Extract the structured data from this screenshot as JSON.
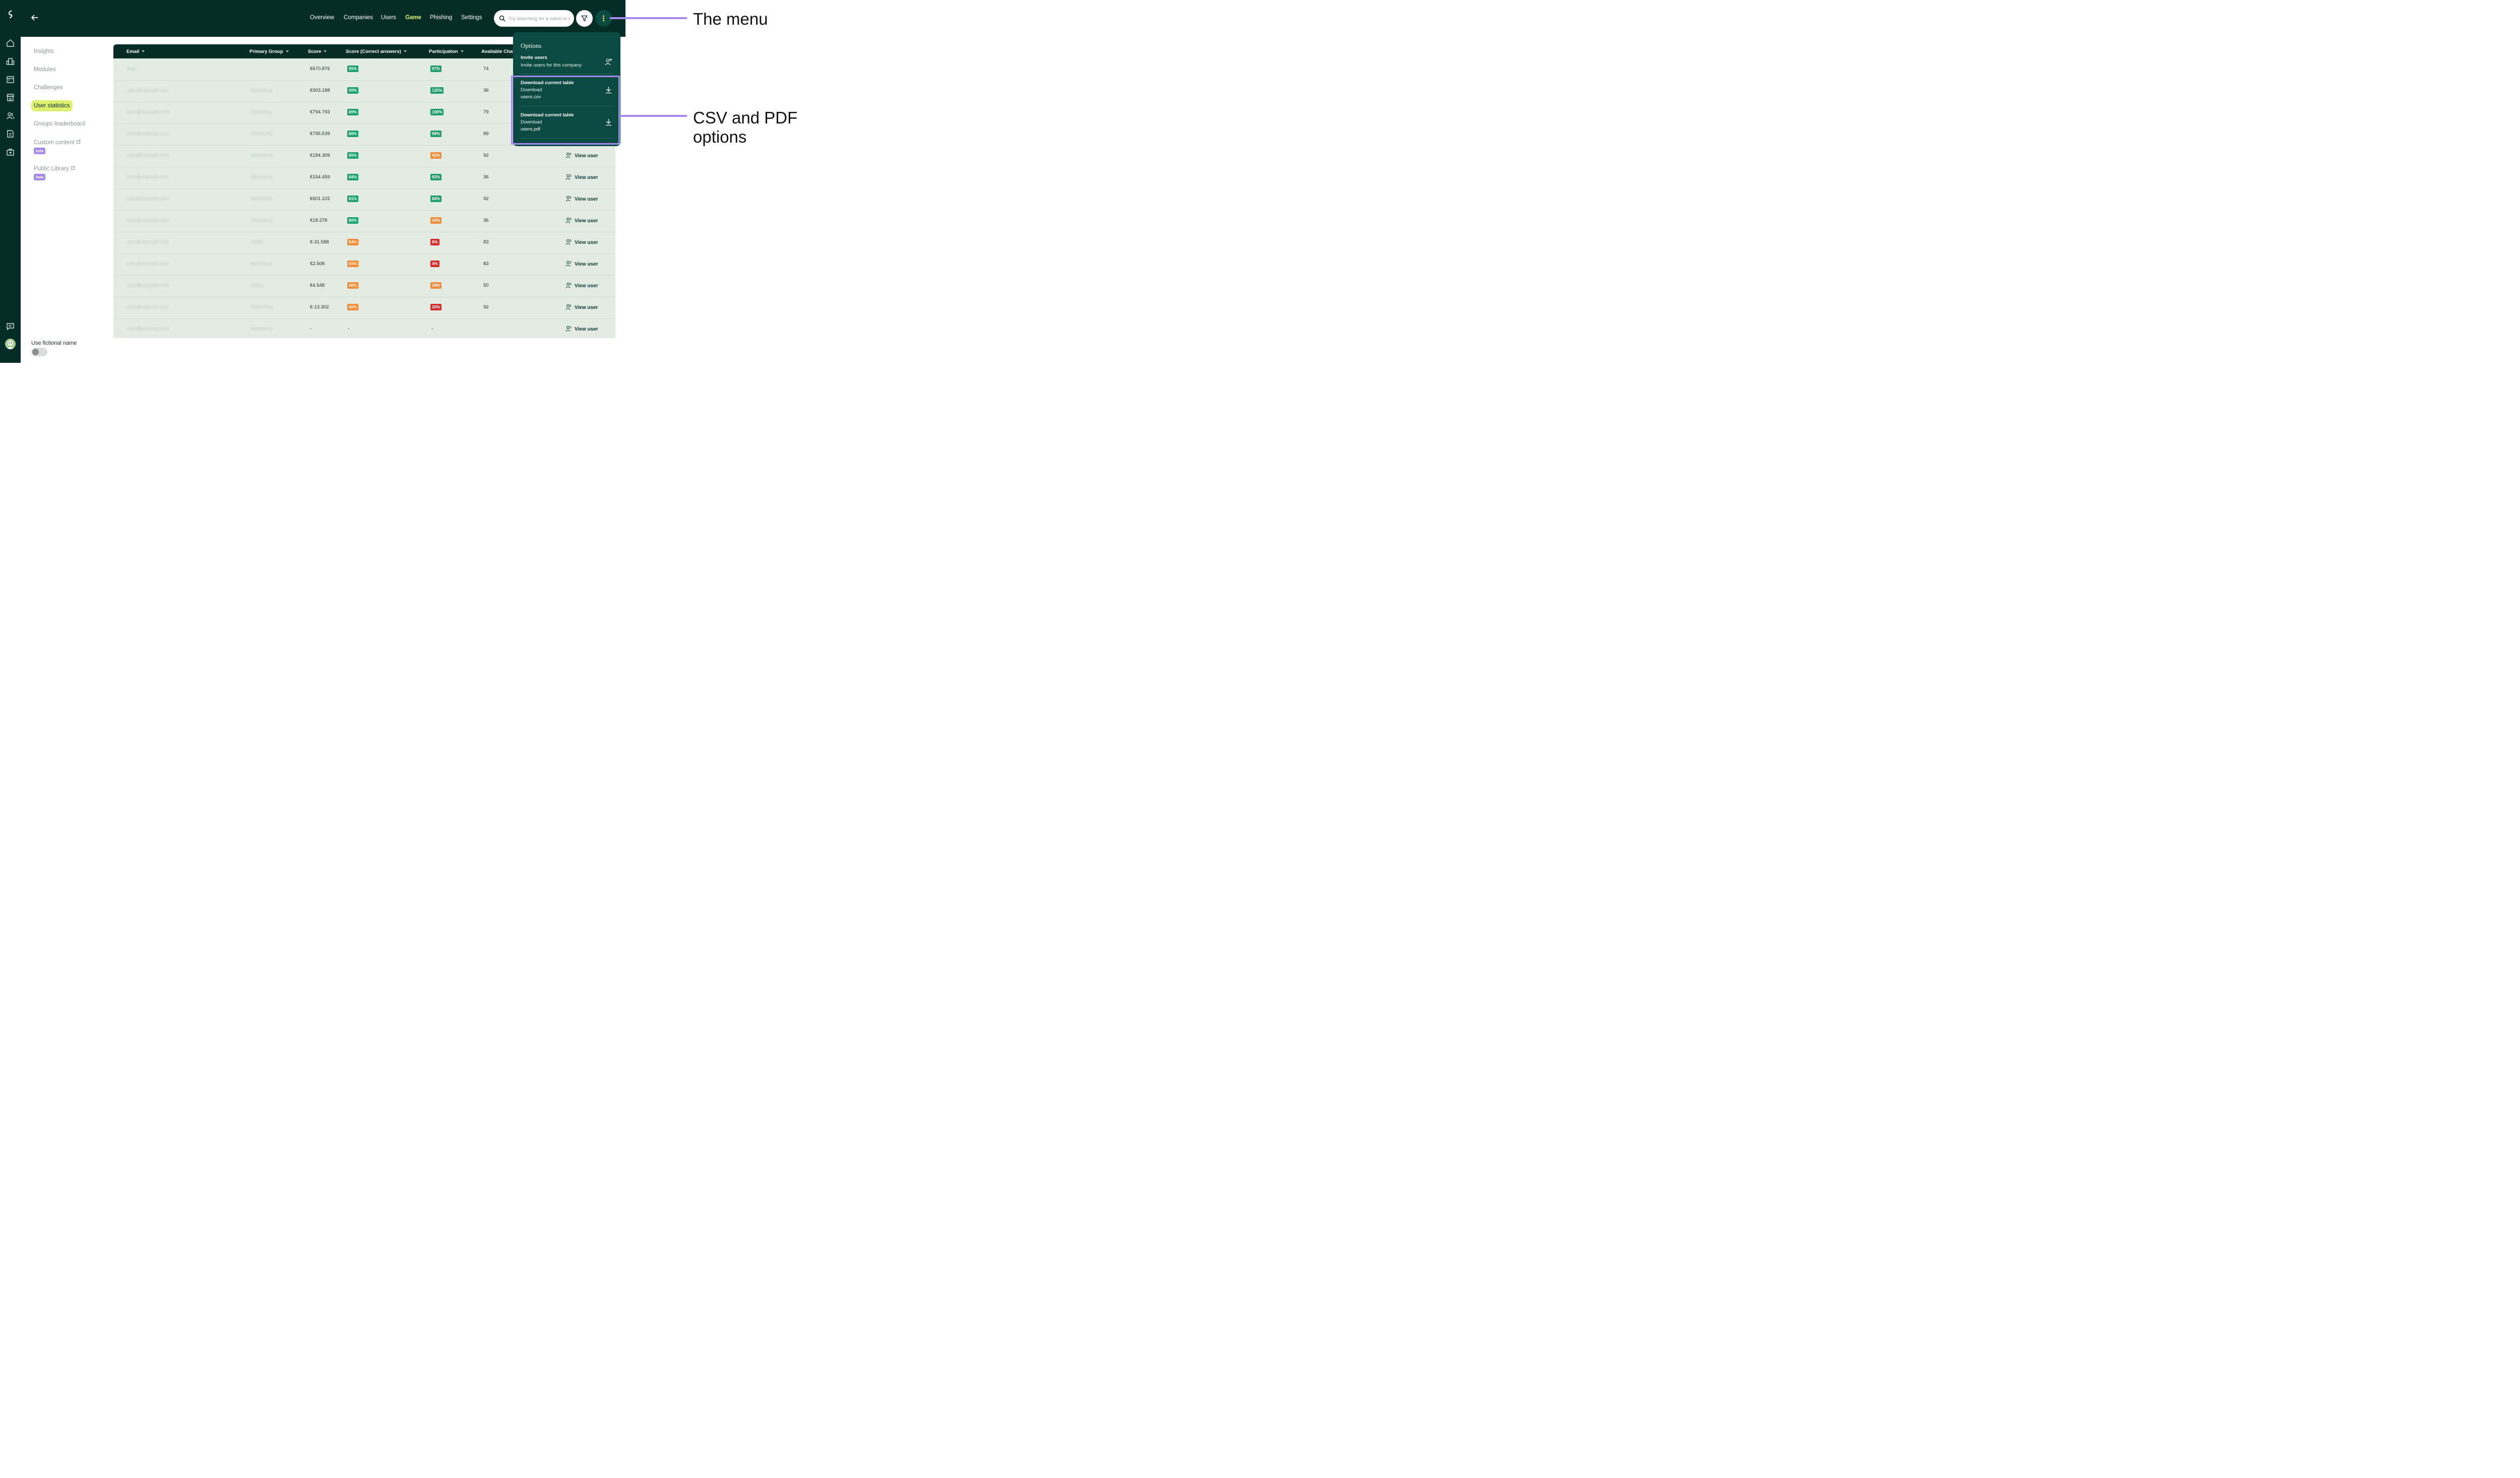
{
  "nav": {
    "tabs": [
      {
        "label": "Overview"
      },
      {
        "label": "Companies"
      },
      {
        "label": "Users"
      },
      {
        "label": "Game",
        "active": true
      },
      {
        "label": "Phishing"
      },
      {
        "label": "Settings"
      }
    ]
  },
  "search": {
    "placeholder": "Try searching for a name or e"
  },
  "sidebar": {
    "items": [
      {
        "label": "Insights"
      },
      {
        "label": "Modules"
      },
      {
        "label": "Challenges"
      },
      {
        "label": "User statistics",
        "active": true
      },
      {
        "label": "Groups leaderboard"
      },
      {
        "label": "Custom content",
        "badge": "beta",
        "external": true
      },
      {
        "label": "Public Library",
        "badge": "beta",
        "external": true
      }
    ],
    "toggle_label": "Use fictional name",
    "toggle_on": false
  },
  "leftbar_icons": [
    "logo-icon",
    "home-icon",
    "companies-icon",
    "calendar-icon",
    "store-icon",
    "users-icon",
    "reports-icon",
    "medical-kit-icon",
    "chat-icon",
    "avatar"
  ],
  "table": {
    "headers": [
      "Email",
      "Primary Group",
      "Score",
      "Score (Correct answers)",
      "Participation",
      "Available Chal"
    ],
    "view_label": "View user",
    "rows": [
      {
        "email": "user",
        "group": "",
        "score": "€670.876",
        "correct": "95%",
        "correct_color": "#1f9e6e",
        "part": "97%",
        "part_color": "#1f9e6e",
        "available": "74"
      },
      {
        "email": "user@example.com",
        "group": "Marketing",
        "score": "€303.188",
        "correct": "90%",
        "correct_color": "#1f9e6e",
        "part": "125%",
        "part_color": "#1f9e6e",
        "available": "36"
      },
      {
        "email": "user@example.com",
        "group": "Marketing",
        "score": "€794.793",
        "correct": "89%",
        "correct_color": "#1f9e6e",
        "part": "100%",
        "part_color": "#1f9e6e",
        "available": "79"
      },
      {
        "email": "user@example.com",
        "group": "Marketing",
        "score": "€795.539",
        "correct": "86%",
        "correct_color": "#1f9e6e",
        "part": "99%",
        "part_color": "#1f9e6e",
        "available": "89"
      },
      {
        "email": "user@example.com",
        "group": "Marketing",
        "score": "€184.309",
        "correct": "85%",
        "correct_color": "#1f9e6e",
        "part": "42%",
        "part_color": "#f28c38",
        "available": "92"
      },
      {
        "email": "user@example.com",
        "group": "Marketing",
        "score": "€154.459",
        "correct": "84%",
        "correct_color": "#1f9e6e",
        "part": "92%",
        "part_color": "#1f9e6e",
        "available": "36"
      },
      {
        "email": "user@example.com",
        "group": "Marketing",
        "score": "€601.102",
        "correct": "81%",
        "correct_color": "#1f9e6e",
        "part": "84%",
        "part_color": "#1f9e6e",
        "available": "92"
      },
      {
        "email": "user@example.com",
        "group": "Marketing",
        "score": "€18.278",
        "correct": "80%",
        "correct_color": "#1f9e6e",
        "part": "42%",
        "part_color": "#f28c38",
        "available": "36"
      },
      {
        "email": "user@example.com",
        "group": "Sales",
        "score": "€-31.588",
        "correct": "54%",
        "correct_color": "#f28c38",
        "part": "8%",
        "part_color": "#d92a2a",
        "available": "83"
      },
      {
        "email": "user@example.com",
        "group": "Marketing",
        "score": "€2.508",
        "correct": "50%",
        "correct_color": "#f28c38",
        "part": "4%",
        "part_color": "#d92a2a",
        "available": "83"
      },
      {
        "email": "user@example.com",
        "group": "Sales",
        "score": "€4.548",
        "correct": "48%",
        "correct_color": "#f28c38",
        "part": "34%",
        "part_color": "#f28c38",
        "available": "50"
      },
      {
        "email": "user@example.com",
        "group": "Marketing",
        "score": "€-13.302",
        "correct": "40%",
        "correct_color": "#f28c38",
        "part": "20%",
        "part_color": "#d92a2a",
        "available": "92"
      },
      {
        "email": "user@example.com",
        "group": "Marketing",
        "score": "-",
        "correct": "-",
        "correct_color": "",
        "part": "-",
        "part_color": "",
        "available": ""
      }
    ]
  },
  "menu": {
    "title": "Options",
    "items": [
      {
        "title": "Invite users",
        "subtitle": "Invite users for this company",
        "file": "",
        "icon": "add-user-icon"
      },
      {
        "title": "Download current table",
        "subtitle": "Download",
        "file": "users.csv",
        "icon": "download-icon"
      },
      {
        "title": "Download current table",
        "subtitle": "Download",
        "file": "users.pdf",
        "icon": "download-icon"
      }
    ]
  },
  "annotations": {
    "menu": "The menu",
    "csv_pdf_line1": "CSV and PDF",
    "csv_pdf_line2": "options",
    "color": "#a889f0"
  }
}
